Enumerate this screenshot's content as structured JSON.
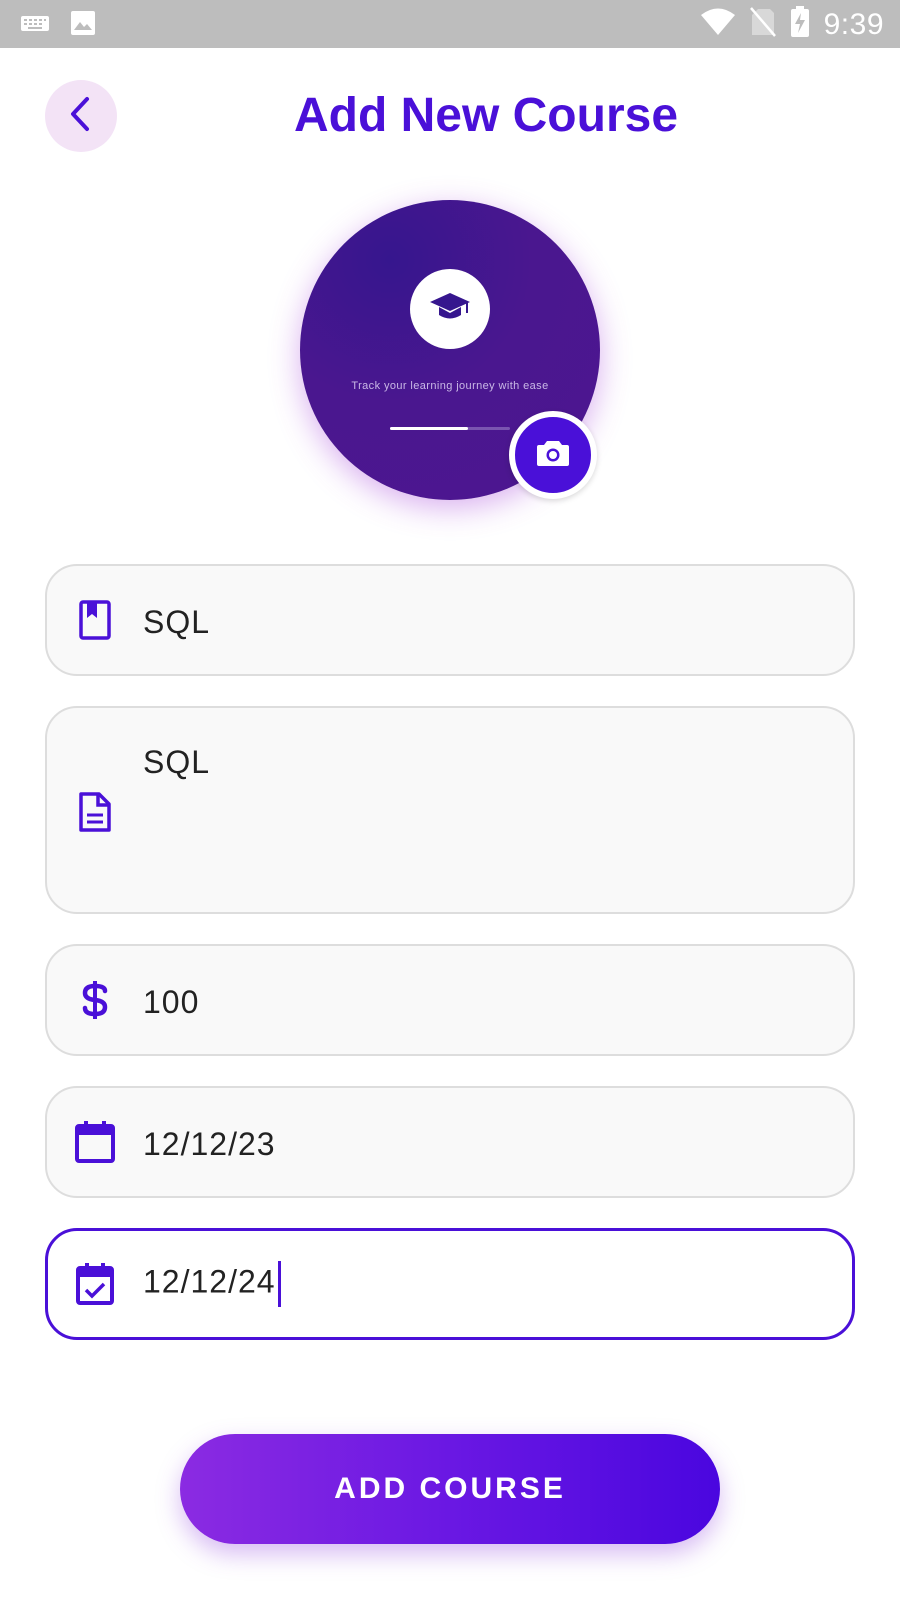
{
  "status_bar": {
    "time": "9:39",
    "icons": [
      "keyboard-icon",
      "image-icon",
      "wifi-icon",
      "no-sim-icon",
      "battery-charging-icon"
    ]
  },
  "header": {
    "title": "Add New Course",
    "back_icon": "chevron-left-icon"
  },
  "cover": {
    "caption": "Track your learning journey with ease",
    "icon": "graduation-cap-icon",
    "camera_icon": "camera-icon",
    "progress": 0.65
  },
  "form": {
    "title": {
      "icon": "book-icon",
      "value": "SQL"
    },
    "description": {
      "icon": "document-icon",
      "value": "SQL"
    },
    "price": {
      "icon": "dollar-icon",
      "value": "100"
    },
    "start_date": {
      "icon": "calendar-icon",
      "value": "12/12/23"
    },
    "end_date": {
      "icon": "calendar-check-icon",
      "value": "12/12/24"
    }
  },
  "submit": {
    "label": "ADD COURSE"
  },
  "colors": {
    "accent": "#4a10d8",
    "back_button_bg": "#f3e3f6",
    "gradient_start": "#8b2be2",
    "gradient_end": "#4a06df"
  }
}
